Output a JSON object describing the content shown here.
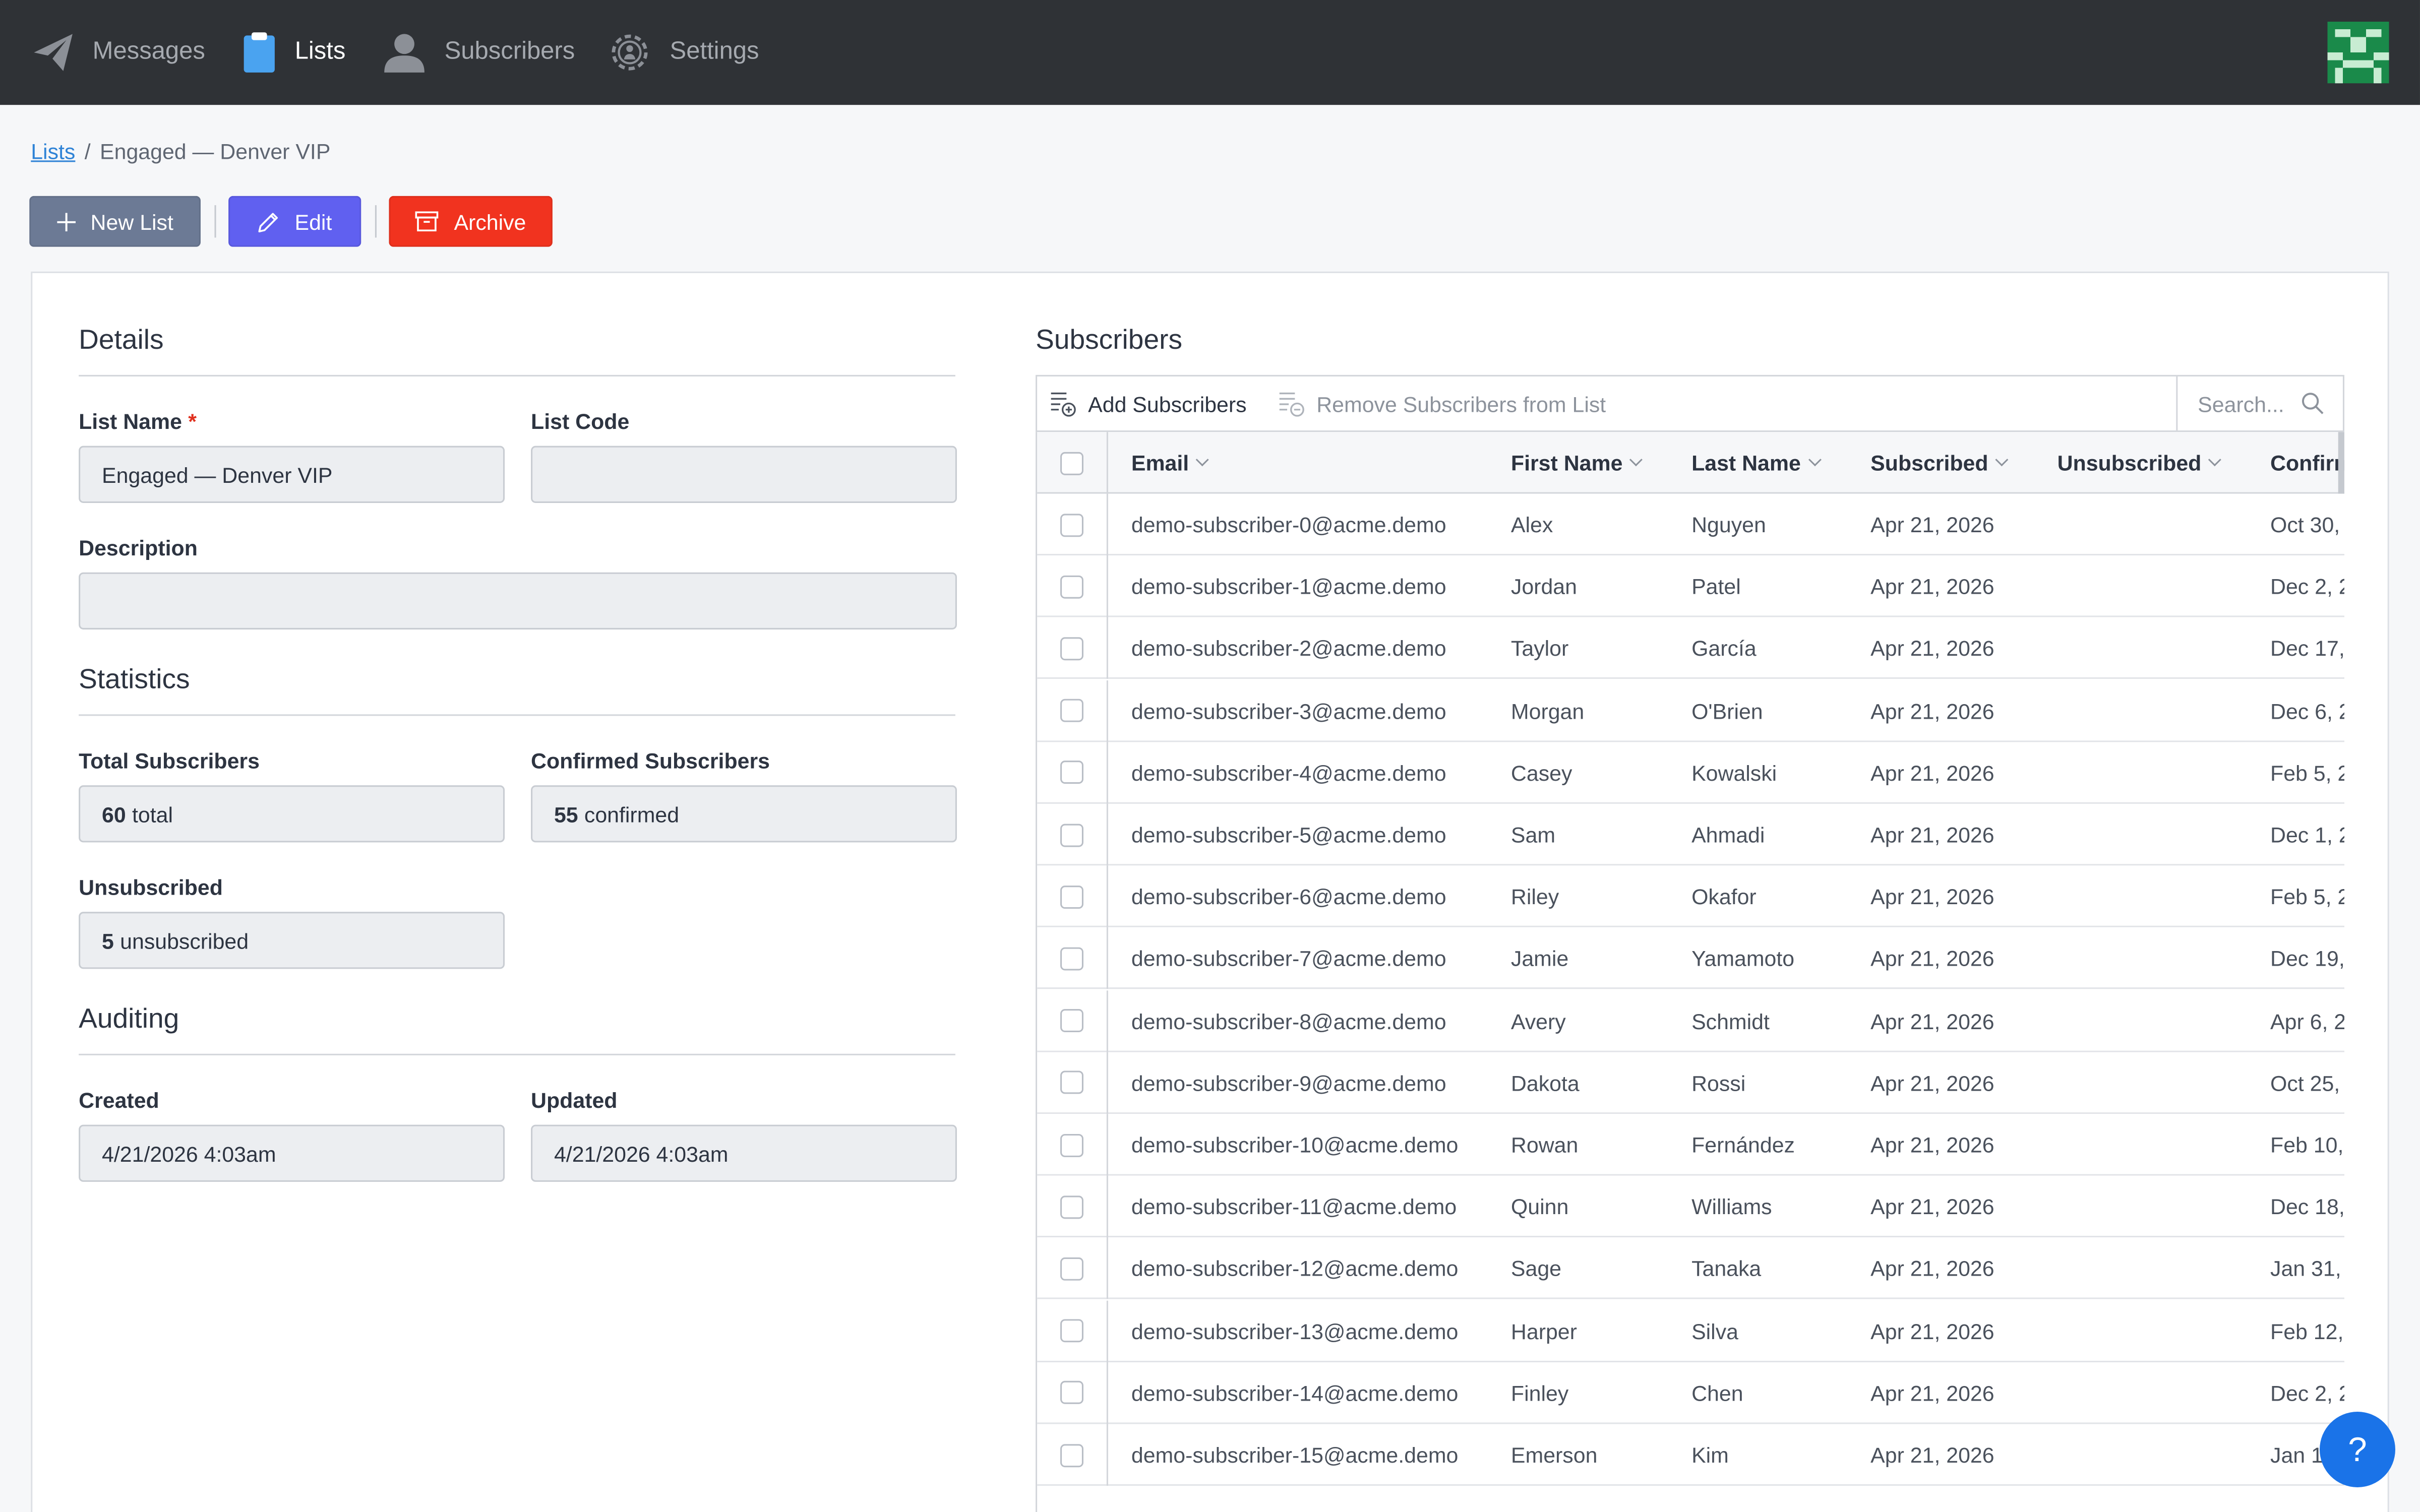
{
  "nav": {
    "items": [
      {
        "label": "Messages",
        "icon": "paper-plane-icon"
      },
      {
        "label": "Lists",
        "icon": "clipboard-icon"
      },
      {
        "label": "Subscribers",
        "icon": "user-icon"
      },
      {
        "label": "Settings",
        "icon": "gear-icon"
      }
    ],
    "active": "Lists"
  },
  "breadcrumb": {
    "root": "Lists",
    "separator": "/",
    "current": "Engaged — Denver VIP"
  },
  "toolbar": {
    "new_label": "New List",
    "edit_label": "Edit",
    "archive_label": "Archive"
  },
  "details": {
    "title": "Details",
    "list_name_label": "List Name",
    "required_mark": "*",
    "list_name_value": "Engaged — Denver VIP",
    "list_code_label": "List Code",
    "list_code_value": "",
    "description_label": "Description",
    "description_value": ""
  },
  "statistics": {
    "title": "Statistics",
    "total_label": "Total Subscribers",
    "total_value": "60",
    "total_suffix": "total",
    "confirmed_label": "Confirmed Subscribers",
    "confirmed_value": "55",
    "confirmed_suffix": "confirmed",
    "unsubscribed_label": "Unsubscribed",
    "unsubscribed_value": "5",
    "unsubscribed_suffix": "unsubscribed"
  },
  "auditing": {
    "title": "Auditing",
    "created_label": "Created",
    "created_value": "4/21/2026 4:03am",
    "updated_label": "Updated",
    "updated_value": "4/21/2026 4:03am"
  },
  "subscribers": {
    "title": "Subscribers",
    "add_label": "Add Subscribers",
    "remove_label": "Remove Subscribers from List",
    "search_placeholder": "Search...",
    "columns": [
      "Email",
      "First Name",
      "Last Name",
      "Subscribed",
      "Unsubscribed",
      "Confirm"
    ],
    "rows": [
      {
        "email": "demo-subscriber-0@acme.demo",
        "first": "Alex",
        "last": "Nguyen",
        "subscribed": "Apr 21, 2026",
        "unsubscribed": "",
        "confirmed": "Oct 30,"
      },
      {
        "email": "demo-subscriber-1@acme.demo",
        "first": "Jordan",
        "last": "Patel",
        "subscribed": "Apr 21, 2026",
        "unsubscribed": "",
        "confirmed": "Dec 2, 2"
      },
      {
        "email": "demo-subscriber-2@acme.demo",
        "first": "Taylor",
        "last": "García",
        "subscribed": "Apr 21, 2026",
        "unsubscribed": "",
        "confirmed": "Dec 17,"
      },
      {
        "email": "demo-subscriber-3@acme.demo",
        "first": "Morgan",
        "last": "O'Brien",
        "subscribed": "Apr 21, 2026",
        "unsubscribed": "",
        "confirmed": "Dec 6, 2"
      },
      {
        "email": "demo-subscriber-4@acme.demo",
        "first": "Casey",
        "last": "Kowalski",
        "subscribed": "Apr 21, 2026",
        "unsubscribed": "",
        "confirmed": "Feb 5, 2"
      },
      {
        "email": "demo-subscriber-5@acme.demo",
        "first": "Sam",
        "last": "Ahmadi",
        "subscribed": "Apr 21, 2026",
        "unsubscribed": "",
        "confirmed": "Dec 1, 2"
      },
      {
        "email": "demo-subscriber-6@acme.demo",
        "first": "Riley",
        "last": "Okafor",
        "subscribed": "Apr 21, 2026",
        "unsubscribed": "",
        "confirmed": "Feb 5, 2"
      },
      {
        "email": "demo-subscriber-7@acme.demo",
        "first": "Jamie",
        "last": "Yamamoto",
        "subscribed": "Apr 21, 2026",
        "unsubscribed": "",
        "confirmed": "Dec 19,"
      },
      {
        "email": "demo-subscriber-8@acme.demo",
        "first": "Avery",
        "last": "Schmidt",
        "subscribed": "Apr 21, 2026",
        "unsubscribed": "",
        "confirmed": "Apr 6, 2"
      },
      {
        "email": "demo-subscriber-9@acme.demo",
        "first": "Dakota",
        "last": "Rossi",
        "subscribed": "Apr 21, 2026",
        "unsubscribed": "",
        "confirmed": "Oct 25,"
      },
      {
        "email": "demo-subscriber-10@acme.demo",
        "first": "Rowan",
        "last": "Fernández",
        "subscribed": "Apr 21, 2026",
        "unsubscribed": "",
        "confirmed": "Feb 10,"
      },
      {
        "email": "demo-subscriber-11@acme.demo",
        "first": "Quinn",
        "last": "Williams",
        "subscribed": "Apr 21, 2026",
        "unsubscribed": "",
        "confirmed": "Dec 18,"
      },
      {
        "email": "demo-subscriber-12@acme.demo",
        "first": "Sage",
        "last": "Tanaka",
        "subscribed": "Apr 21, 2026",
        "unsubscribed": "",
        "confirmed": "Jan 31,"
      },
      {
        "email": "demo-subscriber-13@acme.demo",
        "first": "Harper",
        "last": "Silva",
        "subscribed": "Apr 21, 2026",
        "unsubscribed": "",
        "confirmed": "Feb 12,"
      },
      {
        "email": "demo-subscriber-14@acme.demo",
        "first": "Finley",
        "last": "Chen",
        "subscribed": "Apr 21, 2026",
        "unsubscribed": "",
        "confirmed": "Dec 2, 2"
      },
      {
        "email": "demo-subscriber-15@acme.demo",
        "first": "Emerson",
        "last": "Kim",
        "subscribed": "Apr 21, 2026",
        "unsubscribed": "",
        "confirmed": "Jan 1"
      }
    ]
  },
  "help": {
    "label": "?"
  },
  "colors": {
    "nav_bg": "#2f3236",
    "link": "#2f83d6",
    "new_button": "#6c7a95",
    "edit_button": "#6060f0",
    "archive_button": "#f1331f",
    "help_button": "#1a73e8"
  }
}
